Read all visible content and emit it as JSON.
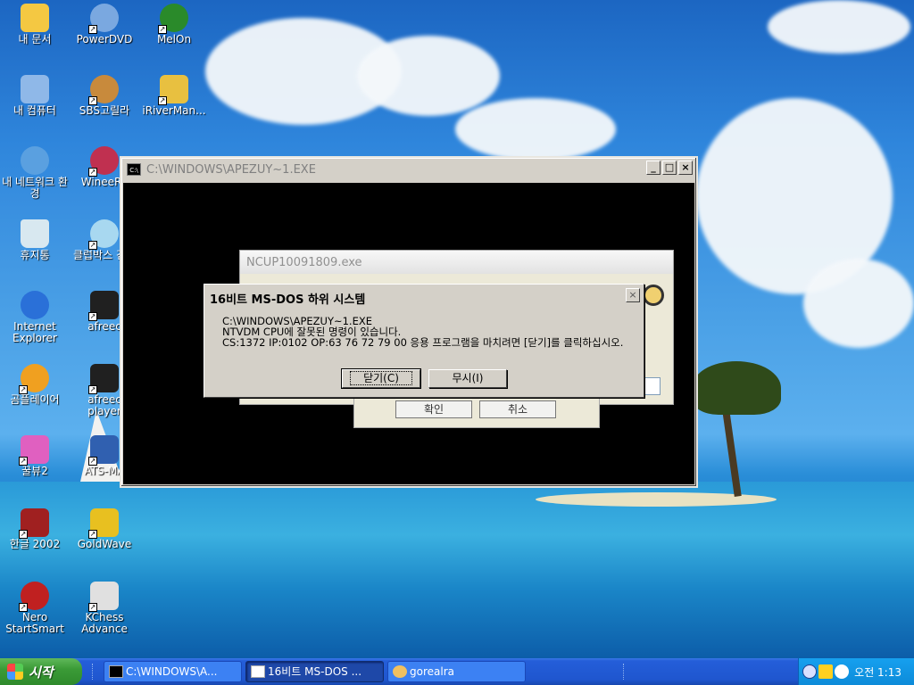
{
  "desktop": {
    "icons": [
      {
        "label": "내 문서",
        "icon": "folder-icon",
        "color": "#f4c842"
      },
      {
        "label": "PowerDVD",
        "icon": "dvd-icon",
        "color": "#7aa8e0"
      },
      {
        "label": "MelOn",
        "icon": "melon-icon",
        "color": "#2a8a2a"
      },
      {
        "label": "내 컴퓨터",
        "icon": "computer-icon",
        "color": "#8fb8e8"
      },
      {
        "label": "SBS고릴라",
        "icon": "gorilla-icon",
        "color": "#c88a3c"
      },
      {
        "label": "iRiverMan...",
        "icon": "iriver-icon",
        "color": "#e8c040"
      },
      {
        "label": "내 네트워크 환경",
        "icon": "network-icon",
        "color": "#5aa0e0"
      },
      {
        "label": "WineeRe",
        "icon": "winee-icon",
        "color": "#c03050"
      },
      {
        "label": "휴지통",
        "icon": "recycle-bin-icon",
        "color": "#d8e8f0"
      },
      {
        "label": "클럽박스 검색",
        "icon": "clubbox-icon",
        "color": "#a8d8f0"
      },
      {
        "label": "Internet Explorer",
        "icon": "internet-explorer-icon",
        "color": "#2a70d8"
      },
      {
        "label": "afreec",
        "icon": "afreeca-icon",
        "color": "#202020"
      },
      {
        "label": "곰플레이어",
        "icon": "gomplayer-icon",
        "color": "#f0a020"
      },
      {
        "label": "afreec player",
        "icon": "afreeca-player-icon",
        "color": "#202020"
      },
      {
        "label": "꿀뷰2",
        "icon": "honeyview-icon",
        "color": "#e060c0"
      },
      {
        "label": "ATS-MA",
        "icon": "ats-icon",
        "color": "#3060b0"
      },
      {
        "label": "한글 2002",
        "icon": "hangul-icon",
        "color": "#a02020"
      },
      {
        "label": "GoldWave",
        "icon": "goldwave-icon",
        "color": "#e8c020"
      },
      {
        "label": "Nero StartSmart",
        "icon": "nero-icon",
        "color": "#c02020"
      },
      {
        "label": "KChess Advance",
        "icon": "chess-knight-icon",
        "color": "#e0e0e0"
      }
    ]
  },
  "console": {
    "title": "C:\\WINDOWS\\APEZUY~1.EXE",
    "icon_text": "C:\\",
    "minimize": "_",
    "maximize": "□",
    "close": "×"
  },
  "ncup": {
    "title": "NCUP10091809.exe",
    "ok_label": "확인",
    "cancel_label": "취소"
  },
  "error_dialog": {
    "title": "16비트 MS-DOS 하위 시스템",
    "close": "×",
    "lines": [
      "C:\\WINDOWS\\APEZUY~1.EXE",
      "NTVDM CPU에 잘못된 명령이 있습니다.",
      "CS:1372 IP:0102 OP:63 76 72 79 00 응용 프로그램을 마치려면 [닫기]를 클릭하십시오."
    ],
    "close_button": "닫기(C)",
    "ignore_button": "무시(I)"
  },
  "taskbar": {
    "start_label": "시작",
    "tasks": [
      {
        "label": "C:\\WINDOWS\\A..."
      },
      {
        "label": "16비트 MS-DOS ..."
      },
      {
        "label": "gorealra"
      }
    ],
    "clock": "오전 1:13"
  }
}
